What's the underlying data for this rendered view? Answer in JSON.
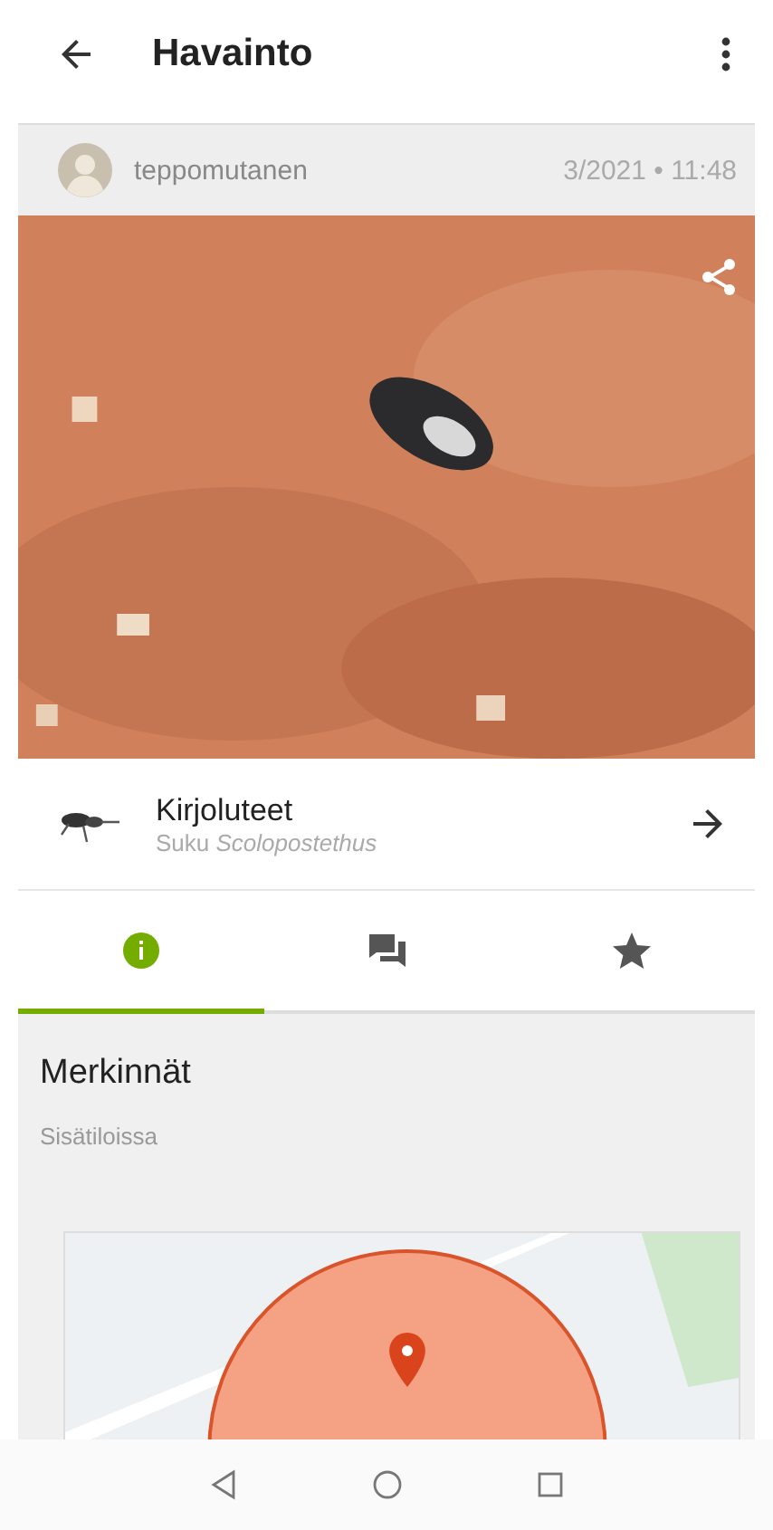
{
  "app_bar": {
    "title": "Havainto"
  },
  "observer": {
    "username": "teppomutanen",
    "date": "3/2021 • 11:48"
  },
  "taxon": {
    "name": "Kirjoluteet",
    "rank": "Suku *Scolopostethus*"
  },
  "tabs": [
    {
      "kind": "info",
      "selected": true
    },
    {
      "kind": "comments",
      "selected": false
    },
    {
      "kind": "favorites",
      "selected": false
    }
  ],
  "annotations": {
    "title": "Merkinnät",
    "text": "Sisätiloissa"
  }
}
